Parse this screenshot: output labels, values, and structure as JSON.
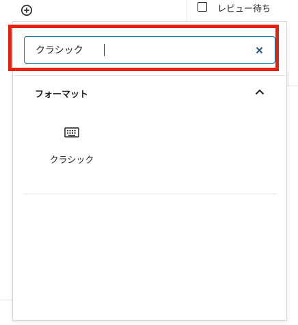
{
  "editor": {
    "review_label": "レビュー待ち"
  },
  "inserter": {
    "search": {
      "value": "クラシック",
      "placeholder": ""
    },
    "panel": {
      "title": "フォーマット",
      "collapse_icon": "chevron-up-icon"
    },
    "blocks": [
      {
        "label": "クラシック",
        "icon": "keyboard-icon"
      }
    ],
    "highlight_color": "#e8210f",
    "accent_color": "#0073aa"
  }
}
